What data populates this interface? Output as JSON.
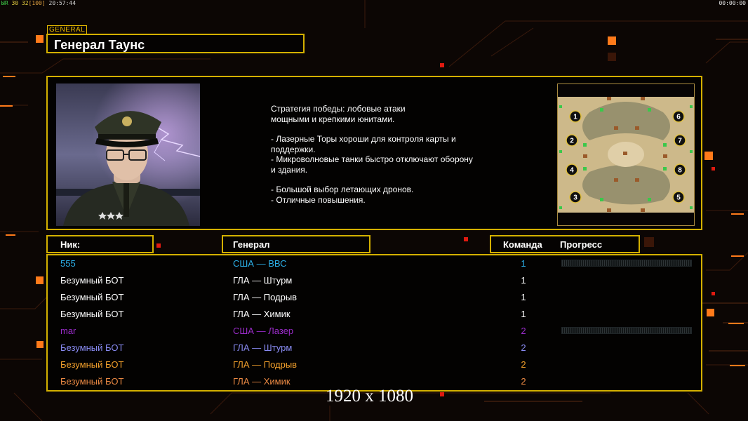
{
  "hud": {
    "top_left_prefix": "ЫR",
    "top_left_a": "30",
    "top_left_b": "32",
    "top_left_c": "[100]",
    "top_left_time": "20:57:44",
    "top_right_time": "00:00:00"
  },
  "general": {
    "tag": "GENERAL",
    "name": "Генерал Таунс",
    "description": [
      "Стратегия победы: лобовые атаки\nмощными и крепкими юнитами.",
      "- Лазерные Торы хороши для контроля карты и\n  поддержки.\n- Микроволновые танки быстро отключают оборону\n  и здания.",
      "- Большой выбор летающих дронов.\n- Отличные повышения."
    ]
  },
  "map": {
    "slots": [
      "1",
      "2",
      "3",
      "4",
      "5",
      "6",
      "7",
      "8"
    ]
  },
  "headers": {
    "nick": "Ник:",
    "general": "Генерал",
    "team": "Команда",
    "progress": "Прогресс"
  },
  "players": [
    {
      "nick": "555",
      "general": "США — ВВС",
      "team": "1",
      "color": "#2cb0e8",
      "show_progress": true
    },
    {
      "nick": "Безумный БОТ",
      "general": "ГЛА — Штурм",
      "team": "1",
      "color": "#ffffff",
      "show_progress": false
    },
    {
      "nick": "Безумный БОТ",
      "general": "ГЛА — Подрыв",
      "team": "1",
      "color": "#ffffff",
      "show_progress": false
    },
    {
      "nick": "Безумный БОТ",
      "general": "ГЛА — Химик",
      "team": "1",
      "color": "#ffffff",
      "show_progress": false
    },
    {
      "nick": "mar",
      "general": "США — Лазер",
      "team": "2",
      "color": "#9a2cc8",
      "show_progress": true
    },
    {
      "nick": "Безумный БОТ",
      "general": "ГЛА — Штурм",
      "team": "2",
      "color": "#8a8cf4",
      "show_progress": false
    },
    {
      "nick": "Безумный БОТ",
      "general": "ГЛА — Подрыв",
      "team": "2",
      "color": "#f2a02c",
      "show_progress": false
    },
    {
      "nick": "Безумный БОТ",
      "general": "ГЛА — Химик",
      "team": "2",
      "color": "#ec8a44",
      "show_progress": false
    }
  ],
  "resolution_label": "1920 x 1080",
  "colors": {
    "frame": "#d4b000",
    "accent_orange": "#ff7a1a",
    "accent_red": "#e01a10"
  }
}
